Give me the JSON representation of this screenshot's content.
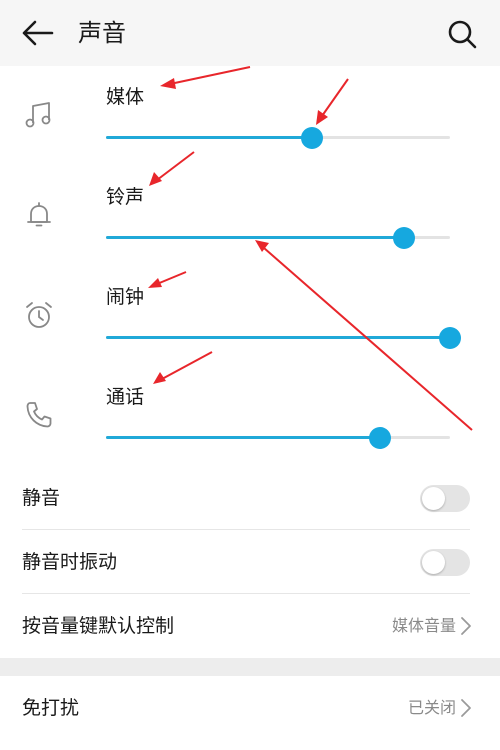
{
  "header": {
    "title": "声音"
  },
  "volumes": [
    {
      "label": "媒体",
      "icon": "music-note-icon",
      "level": 0.6
    },
    {
      "label": "铃声",
      "icon": "bell-icon",
      "level": 0.867
    },
    {
      "label": "闹钟",
      "icon": "alarm-clock-icon",
      "level": 1.0
    },
    {
      "label": "通话",
      "icon": "phone-icon",
      "level": 0.797
    }
  ],
  "settings": {
    "mute": {
      "label": "静音",
      "on": false
    },
    "vibrate_on_mute": {
      "label": "静音时振动",
      "on": false
    },
    "volume_key_control": {
      "label": "按音量键默认控制",
      "value": "媒体音量"
    },
    "do_not_disturb": {
      "label": "免打扰",
      "value": "已关闭"
    }
  },
  "colors": {
    "accent": "#16a8df",
    "annotation": "#e8262b"
  }
}
